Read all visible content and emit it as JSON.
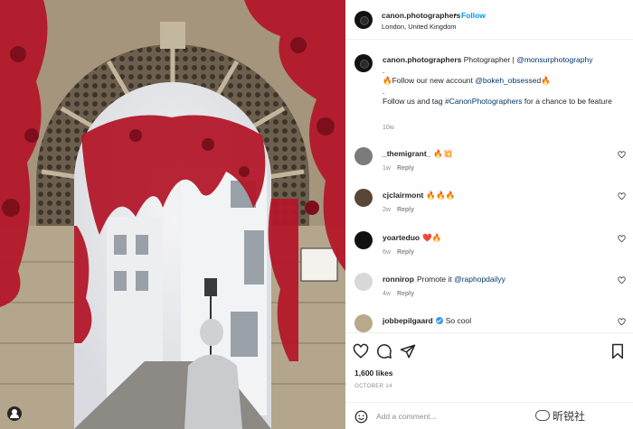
{
  "post": {
    "header": {
      "username": "canon.photographers",
      "separator": "•",
      "follow_label": "Follow",
      "location": "London, United Kingdom"
    },
    "caption": {
      "username": "canon.photographers",
      "text_1": "Photographer |",
      "mention_1": "@monsurphotography",
      "line_2_prefix": "Follow our new account",
      "mention_2": "@bokeh_obsessed",
      "line_3_prefix": "Follow us and tag",
      "hashtag": "#CanonPhotographers",
      "line_3_suffix": "for a chance to be feature",
      "fire_emoji": "🔥",
      "dot": ".",
      "time": "10w"
    },
    "comments": [
      {
        "username": "_themigrant_",
        "text": "🔥💥",
        "time": "1w",
        "reply_label": "Reply",
        "avatar_color": "#7b7b7b"
      },
      {
        "username": "cjclairmont",
        "text": "🔥🔥🔥",
        "time": "2w",
        "reply_label": "Reply",
        "avatar_color": "#5a4636"
      },
      {
        "username": "yoarteduo",
        "text": "❤️🔥",
        "time": "6w",
        "reply_label": "Reply",
        "avatar_color": "#111111"
      },
      {
        "username": "ronnirop",
        "text": "Promote it",
        "mention": "@raphopdailyy",
        "time": "4w",
        "reply_label": "Reply",
        "avatar_color": "#d8d8d8"
      },
      {
        "username": "jobbepilgaard",
        "text": "So cool",
        "verified": true,
        "avatar_color": "#b8a98a"
      }
    ],
    "likes": "1,600 likes",
    "date": "OCTOBER 14",
    "add_comment_placeholder": "Add a comment...",
    "watermark": "昕锐社"
  },
  "icons": {
    "like": "heart-icon",
    "comment": "comment-bubble-icon",
    "share": "paper-plane-icon",
    "save": "bookmark-icon",
    "emoji": "smiley-icon",
    "user_tag": "user-tag-icon"
  },
  "colors": {
    "accent": "#0095f6",
    "link": "#00376b",
    "muted": "#8e8e8e",
    "leaves": "#b3182a"
  }
}
